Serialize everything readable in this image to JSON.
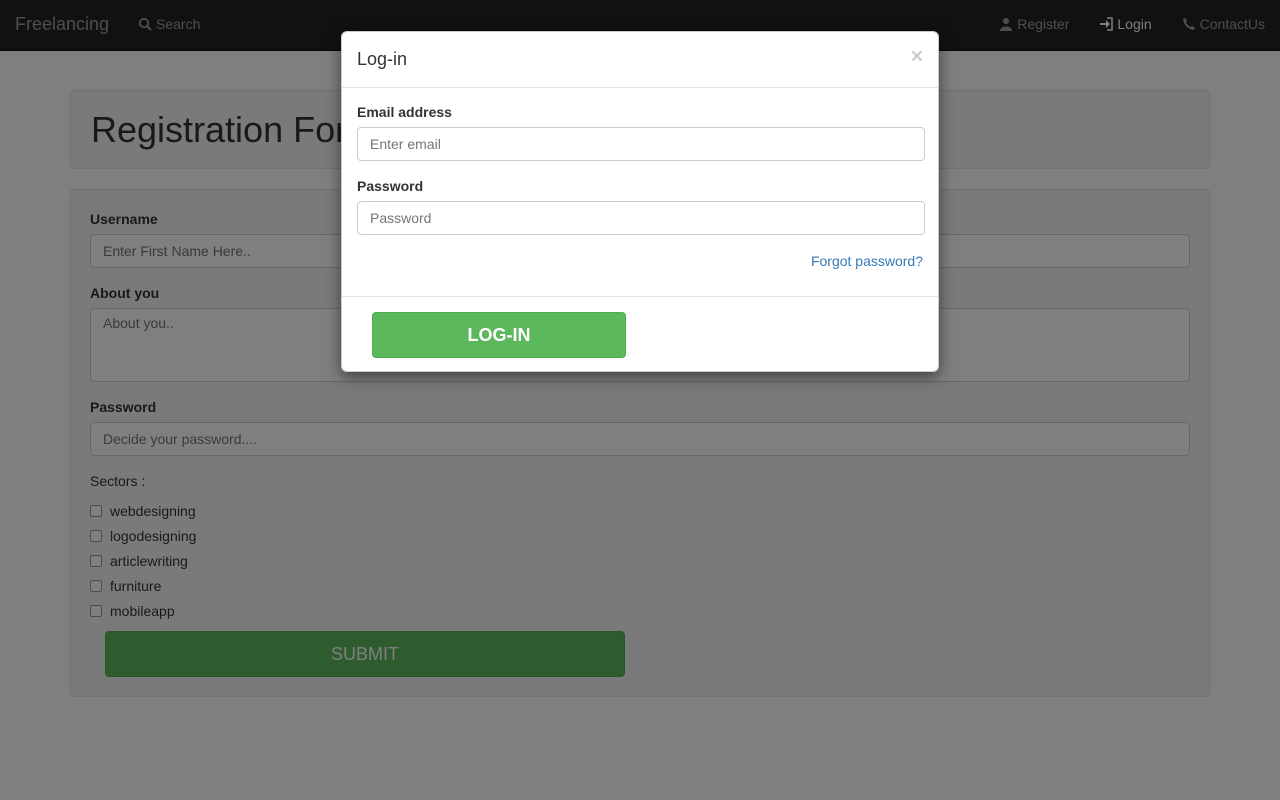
{
  "navbar": {
    "brand": "Freelancing",
    "search_label": "Search",
    "links": [
      {
        "label": "Register",
        "icon": "user-icon"
      },
      {
        "label": "Login",
        "icon": "login-icon"
      },
      {
        "label": "ContactUs",
        "icon": "phone-icon"
      }
    ]
  },
  "page": {
    "title": "Registration Form",
    "form": {
      "username_label": "Username",
      "username_placeholder": "Enter First Name Here..",
      "about_label": "About you",
      "about_placeholder": "About you..",
      "password_label": "Password",
      "password_placeholder": "Decide your password....",
      "sectors_label": "Sectors :",
      "sectors": [
        "webdesigning",
        "logodesigning",
        "articlewriting",
        "furniture",
        "mobileapp"
      ],
      "submit_label": "SUBMIT"
    }
  },
  "modal": {
    "title": "Log-in",
    "close_symbol": "×",
    "email_label": "Email address",
    "email_placeholder": "Enter email",
    "password_label": "Password",
    "password_placeholder": "Password",
    "forgot_label": "Forgot password?",
    "login_button": "LOG-IN"
  },
  "colors": {
    "navbar_bg": "#222222",
    "success_green": "#5cb85c",
    "link_blue": "#337ab7"
  }
}
